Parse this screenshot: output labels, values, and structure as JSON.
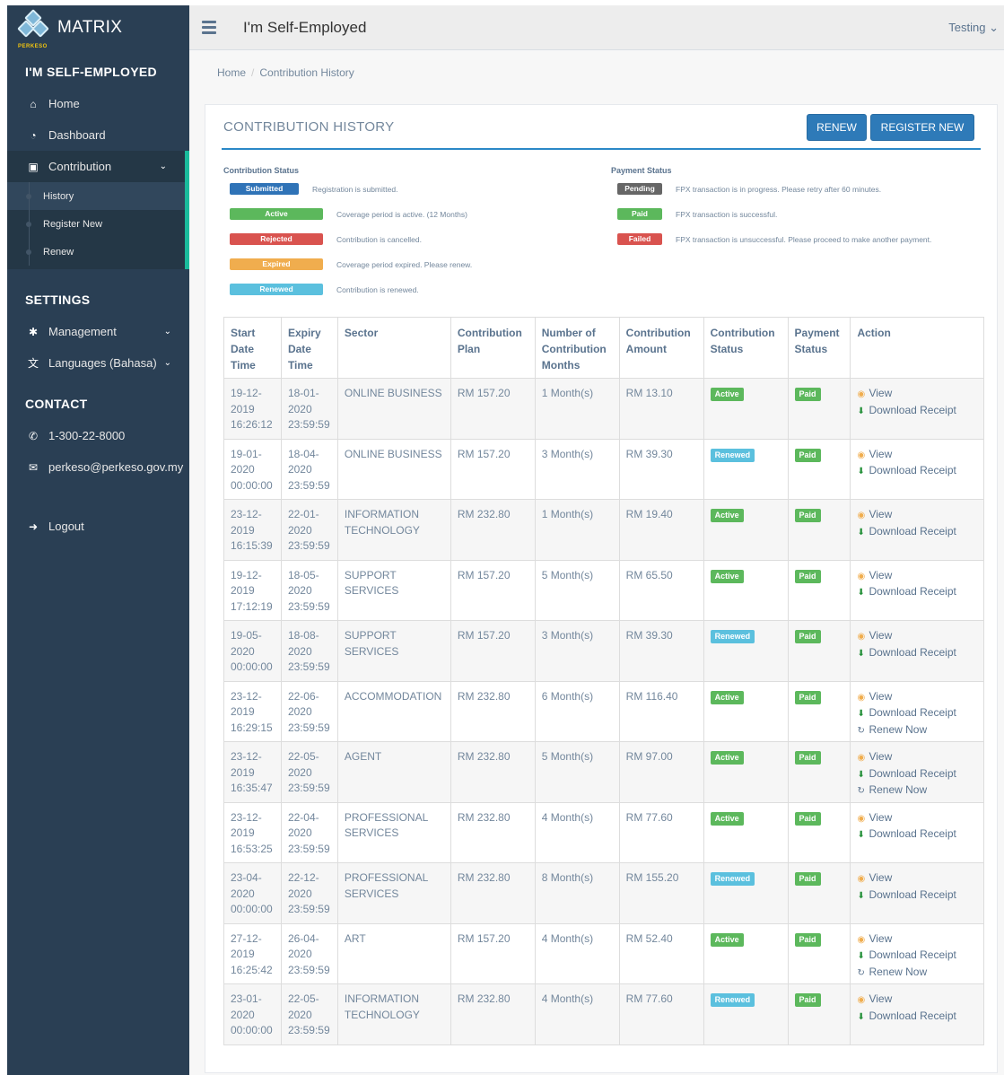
{
  "app": {
    "brand": "MATRIX",
    "logo_text": "PERKESO",
    "page_title": "I'm Self-Employed",
    "user": "Testing ⌄"
  },
  "colors": {
    "sidebar": "#2a3f54",
    "accent": "#1abb9c",
    "primary": "#2e7ab8",
    "submitted": "#2f73b7",
    "active": "#5cb85c",
    "rejected": "#d9534f",
    "expired": "#f0ad4e",
    "renewed": "#5bc0de",
    "pending": "#666666"
  },
  "sidebar": {
    "section_main": "I'M SELF-EMPLOYED",
    "home": {
      "label": "Home",
      "icon": "home-icon"
    },
    "dashboard": {
      "label": "Dashboard",
      "icon": "dashboard-icon"
    },
    "contribution": {
      "label": "Contribution",
      "icon": "money-icon"
    },
    "sub_items": [
      {
        "label": "History"
      },
      {
        "label": "Register New"
      },
      {
        "label": "Renew"
      }
    ],
    "section_settings": "SETTINGS",
    "management": {
      "label": "Management",
      "icon": "gear-icon"
    },
    "languages": {
      "label": "Languages (Bahasa)",
      "icon": "language-icon"
    },
    "section_contact": "CONTACT",
    "phone": {
      "label": "1-300-22-8000",
      "icon": "phone-icon"
    },
    "email": {
      "label": "perkeso@perkeso.gov.my",
      "icon": "envelope-icon"
    },
    "logout": {
      "label": "Logout",
      "icon": "logout-icon"
    }
  },
  "breadcrumb": {
    "home": "Home",
    "current": "Contribution History"
  },
  "panel": {
    "title": "CONTRIBUTION HISTORY",
    "renew_label": "RENEW",
    "register_label": "REGISTER NEW"
  },
  "legend": {
    "contribution_title": "Contribution Status",
    "payment_title": "Payment Status",
    "contribution": [
      {
        "label": "Submitted",
        "desc": "Registration is submitted."
      },
      {
        "label": "Active",
        "desc": "Coverage period is active. (12 Months)"
      },
      {
        "label": "Rejected",
        "desc": "Contribution is cancelled."
      },
      {
        "label": "Expired",
        "desc": "Coverage period expired. Please renew."
      },
      {
        "label": "Renewed",
        "desc": "Contribution is renewed."
      }
    ],
    "payment": [
      {
        "label": "Pending",
        "desc": "FPX transaction is in progress. Please retry after 60 minutes."
      },
      {
        "label": "Paid",
        "desc": "FPX transaction is successful."
      },
      {
        "label": "Failed",
        "desc": "FPX transaction is unsuccessful. Please proceed to make another payment."
      }
    ]
  },
  "table": {
    "headers": [
      "Start Date Time",
      "Expiry Date Time",
      "Sector",
      "Contribution Plan",
      "Number of Contribution Months",
      "Contribution Amount",
      "Contribution Status",
      "Payment Status",
      "Action"
    ],
    "actions": {
      "view": "View",
      "download": "Download Receipt",
      "renew": "Renew Now"
    },
    "rows": [
      {
        "start": "19-12-\n2019\n16:26:12",
        "expiry": "18-01-\n2020\n23:59:59",
        "sector": "ONLINE BUSINESS",
        "plan": "RM 157.20",
        "months": "1 Month(s)",
        "amount": "RM 13.10",
        "status": "Active",
        "payment": "Paid",
        "renew": false
      },
      {
        "start": "19-01-\n2020\n00:00:00",
        "expiry": "18-04-\n2020\n23:59:59",
        "sector": "ONLINE BUSINESS",
        "plan": "RM 157.20",
        "months": "3 Month(s)",
        "amount": "RM 39.30",
        "status": "Renewed",
        "payment": "Paid",
        "renew": false
      },
      {
        "start": "23-12-\n2019\n16:15:39",
        "expiry": "22-01-\n2020\n23:59:59",
        "sector": "INFORMATION\nTECHNOLOGY",
        "plan": "RM 232.80",
        "months": "1 Month(s)",
        "amount": "RM 19.40",
        "status": "Active",
        "payment": "Paid",
        "renew": false
      },
      {
        "start": "19-12-\n2019\n17:12:19",
        "expiry": "18-05-\n2020\n23:59:59",
        "sector": "SUPPORT\nSERVICES",
        "plan": "RM 157.20",
        "months": "5 Month(s)",
        "amount": "RM 65.50",
        "status": "Active",
        "payment": "Paid",
        "renew": false
      },
      {
        "start": "19-05-\n2020\n00:00:00",
        "expiry": "18-08-\n2020\n23:59:59",
        "sector": "SUPPORT\nSERVICES",
        "plan": "RM 157.20",
        "months": "3 Month(s)",
        "amount": "RM 39.30",
        "status": "Renewed",
        "payment": "Paid",
        "renew": false
      },
      {
        "start": "23-12-\n2019\n16:29:15",
        "expiry": "22-06-\n2020\n23:59:59",
        "sector": "ACCOMMODATION",
        "plan": "RM 232.80",
        "months": "6 Month(s)",
        "amount": "RM 116.40",
        "status": "Active",
        "payment": "Paid",
        "renew": true
      },
      {
        "start": "23-12-\n2019\n16:35:47",
        "expiry": "22-05-\n2020\n23:59:59",
        "sector": "AGENT",
        "plan": "RM 232.80",
        "months": "5 Month(s)",
        "amount": "RM 97.00",
        "status": "Active",
        "payment": "Paid",
        "renew": true
      },
      {
        "start": "23-12-\n2019\n16:53:25",
        "expiry": "22-04-\n2020\n23:59:59",
        "sector": "PROFESSIONAL\nSERVICES",
        "plan": "RM 232.80",
        "months": "4 Month(s)",
        "amount": "RM 77.60",
        "status": "Active",
        "payment": "Paid",
        "renew": false
      },
      {
        "start": "23-04-\n2020\n00:00:00",
        "expiry": "22-12-\n2020\n23:59:59",
        "sector": "PROFESSIONAL\nSERVICES",
        "plan": "RM 232.80",
        "months": "8 Month(s)",
        "amount": "RM 155.20",
        "status": "Renewed",
        "payment": "Paid",
        "renew": false
      },
      {
        "start": "27-12-\n2019\n16:25:42",
        "expiry": "26-04-\n2020\n23:59:59",
        "sector": "ART",
        "plan": "RM 157.20",
        "months": "4 Month(s)",
        "amount": "RM 52.40",
        "status": "Active",
        "payment": "Paid",
        "renew": true
      },
      {
        "start": "23-01-\n2020\n00:00:00",
        "expiry": "22-05-\n2020\n23:59:59",
        "sector": "INFORMATION\nTECHNOLOGY",
        "plan": "RM 232.80",
        "months": "4 Month(s)",
        "amount": "RM 77.60",
        "status": "Renewed",
        "payment": "Paid",
        "renew": false
      }
    ]
  }
}
